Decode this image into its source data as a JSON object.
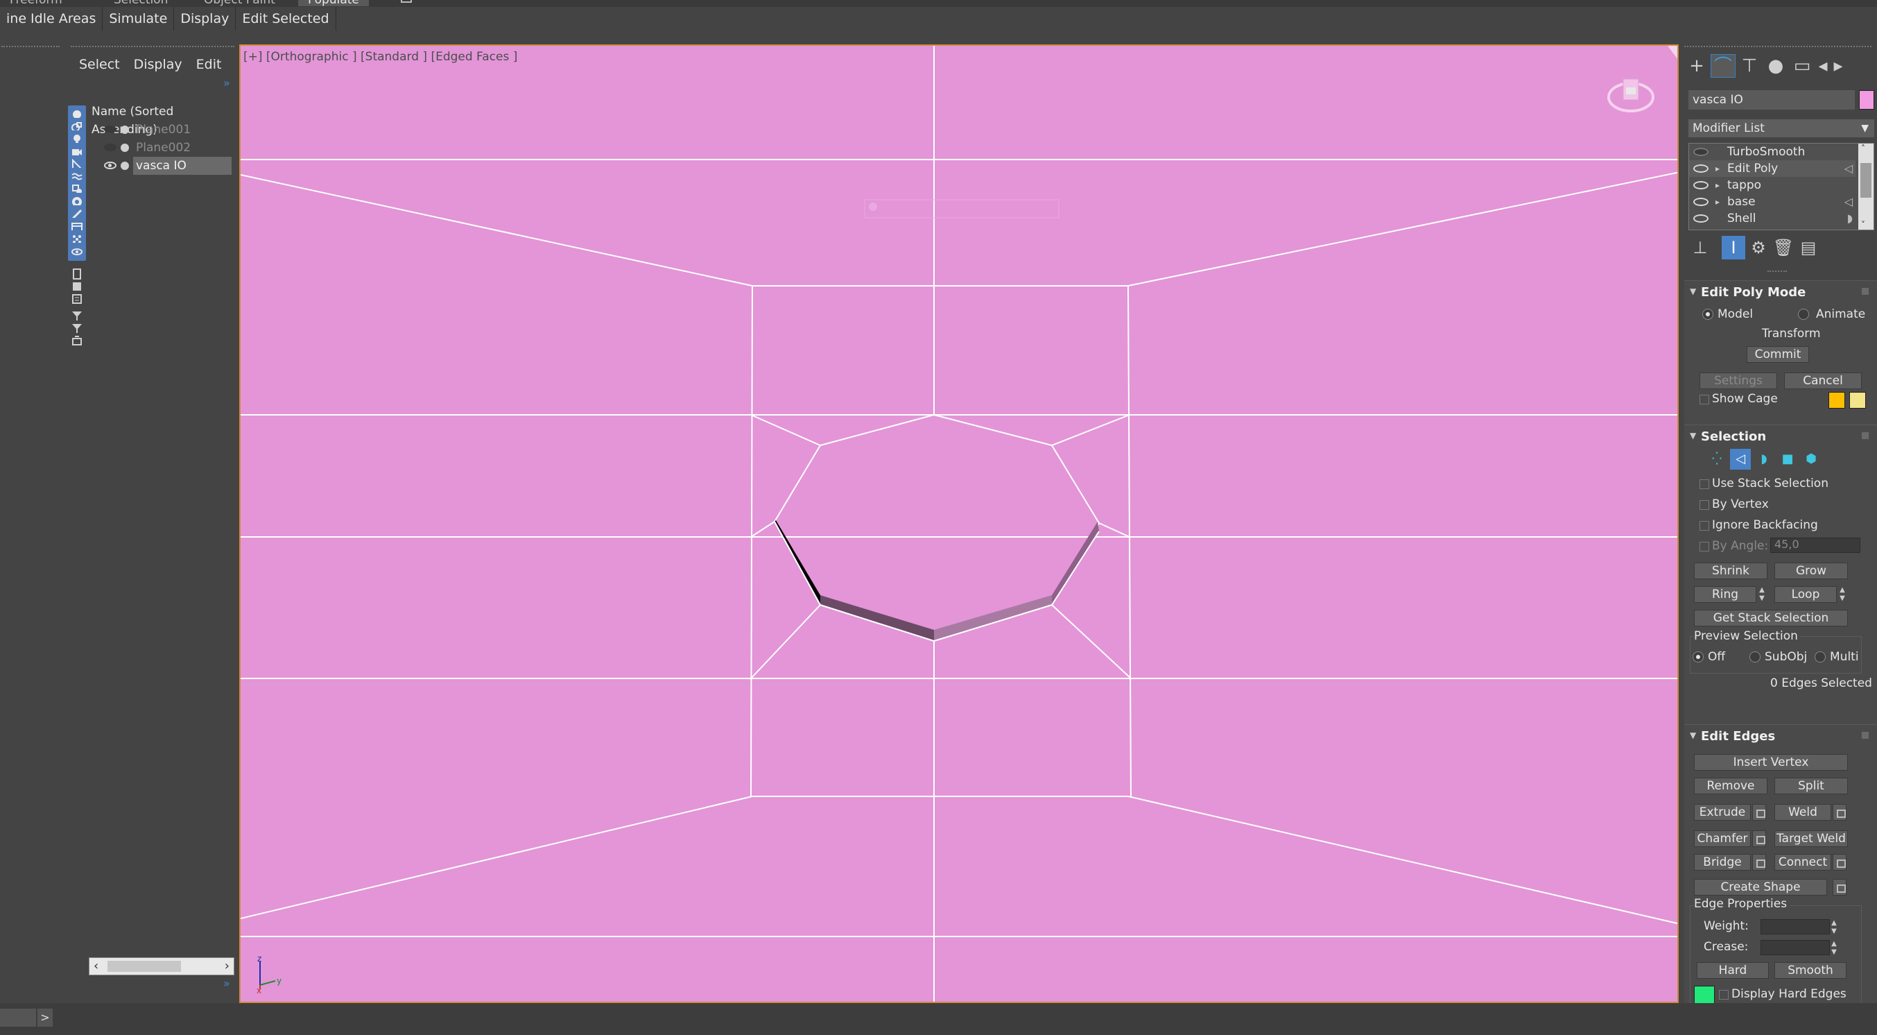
{
  "ribbon_tabs": [
    "Freeform",
    "Selection",
    "Object Paint",
    "Populate"
  ],
  "ribbon_active": "Populate",
  "subtabs": [
    "ine Idle Areas",
    "Simulate",
    "Display",
    "Edit Selected"
  ],
  "explorer": {
    "menu": [
      "Select",
      "Display",
      "Edit"
    ],
    "column_header": "Name (Sorted Ascending)",
    "rows": [
      {
        "name": "Plane001",
        "visible": false,
        "state": "dim"
      },
      {
        "name": "Plane002",
        "visible": false,
        "state": "dim"
      },
      {
        "name": "vasca IO",
        "visible": true,
        "state": "selected"
      }
    ]
  },
  "viewport": {
    "label": "[+] [Orthographic ] [Standard ] [Edged Faces ]",
    "background": "#e395d7",
    "axis_labels": [
      "z",
      "y",
      "x"
    ]
  },
  "command_panel": {
    "tabs": [
      "create",
      "modify",
      "hierarchy",
      "motion",
      "display",
      "utilities"
    ],
    "object_name": "vasca IO",
    "object_color": "#f09be2",
    "modifier_list_label": "Modifier List",
    "stack": [
      {
        "name": "TurboSmooth",
        "visible": false
      },
      {
        "name": "Edit Poly",
        "visible": true,
        "highlight": true
      },
      {
        "name": "tappo",
        "visible": true
      },
      {
        "name": "base",
        "visible": true
      },
      {
        "name": "Shell",
        "visible": true
      }
    ],
    "edit_poly_mode": {
      "title": "Edit Poly Mode",
      "model_label": "Model",
      "animate_label": "Animate",
      "mode": "Model",
      "transform_label": "Transform",
      "commit_label": "Commit",
      "settings_label": "Settings",
      "cancel_label": "Cancel",
      "show_cage_label": "Show Cage",
      "cage_color_1": "#ffbf00",
      "cage_color_2": "#f4e48a"
    },
    "selection": {
      "title": "Selection",
      "use_stack_selection": "Use Stack Selection",
      "by_vertex": "By Vertex",
      "ignore_backfacing": "Ignore Backfacing",
      "by_angle_label": "By Angle:",
      "by_angle_value": "45,0",
      "shrink": "Shrink",
      "grow": "Grow",
      "ring": "Ring",
      "loop": "Loop",
      "get_stack_selection": "Get Stack Selection",
      "preview_selection_label": "Preview Selection",
      "preview_off": "Off",
      "preview_subobj": "SubObj",
      "preview_multi": "Multi",
      "status": "0 Edges Selected"
    },
    "edit_edges": {
      "title": "Edit Edges",
      "insert_vertex": "Insert Vertex",
      "remove": "Remove",
      "split": "Split",
      "extrude": "Extrude",
      "weld": "Weld",
      "chamfer": "Chamfer",
      "target_weld": "Target Weld",
      "bridge": "Bridge",
      "connect": "Connect",
      "create_shape": "Create Shape",
      "edge_properties_label": "Edge Properties",
      "weight_label": "Weight:",
      "crease_label": "Crease:",
      "hard": "Hard",
      "smooth": "Smooth",
      "display_hard_edges": "Display Hard Edges",
      "hard_edge_color": "#22e87a"
    }
  },
  "bottom": {
    "expand_button": ">"
  }
}
